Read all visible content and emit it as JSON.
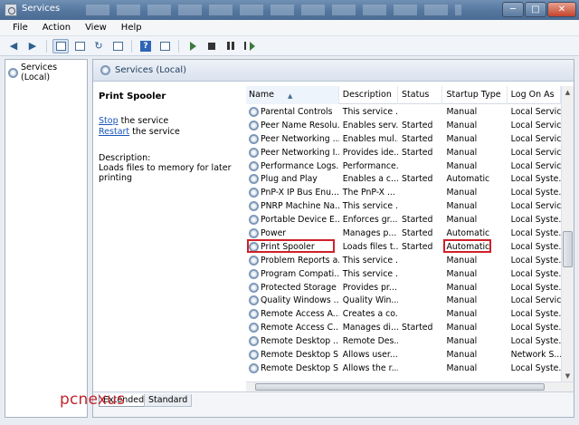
{
  "window": {
    "title": "Services",
    "controls": {
      "minimize": "─",
      "maximize": "□",
      "close": "✕"
    }
  },
  "menu": [
    "File",
    "Action",
    "View",
    "Help"
  ],
  "toolbar": {
    "icons": [
      "back-icon",
      "forward-icon",
      "show-tree-icon",
      "properties-icon",
      "refresh-icon",
      "export-icon",
      "help-icon",
      "view-icon",
      "start-icon",
      "stop-icon",
      "pause-icon",
      "restart-icon"
    ]
  },
  "tree": {
    "root_label": "Services (Local)"
  },
  "pane_header": {
    "title": "Services (Local)"
  },
  "detail": {
    "service_name": "Print Spooler",
    "stop_link": "Stop",
    "stop_suffix": " the service",
    "restart_link": "Restart",
    "restart_suffix": " the service",
    "description_label": "Description:",
    "description_text": "Loads files to memory for later printing"
  },
  "columns": {
    "name": "Name",
    "description": "Description",
    "status": "Status",
    "startup_type": "Startup Type",
    "log_on_as": "Log On As"
  },
  "rows": [
    {
      "name": "Parental Controls",
      "desc": "This service ...",
      "status": "",
      "startup": "Manual",
      "logon": "Local Service"
    },
    {
      "name": "Peer Name Resolu...",
      "desc": "Enables serv...",
      "status": "Started",
      "startup": "Manual",
      "logon": "Local Service"
    },
    {
      "name": "Peer Networking ...",
      "desc": "Enables mul...",
      "status": "Started",
      "startup": "Manual",
      "logon": "Local Service"
    },
    {
      "name": "Peer Networking I...",
      "desc": "Provides ide...",
      "status": "Started",
      "startup": "Manual",
      "logon": "Local Service"
    },
    {
      "name": "Performance Logs...",
      "desc": "Performance...",
      "status": "",
      "startup": "Manual",
      "logon": "Local Service"
    },
    {
      "name": "Plug and Play",
      "desc": "Enables a c...",
      "status": "Started",
      "startup": "Automatic",
      "logon": "Local Syste..."
    },
    {
      "name": "PnP-X IP Bus Enu...",
      "desc": "The PnP-X ...",
      "status": "",
      "startup": "Manual",
      "logon": "Local Syste..."
    },
    {
      "name": "PNRP Machine Na...",
      "desc": "This service ...",
      "status": "",
      "startup": "Manual",
      "logon": "Local Service"
    },
    {
      "name": "Portable Device E...",
      "desc": "Enforces gr...",
      "status": "Started",
      "startup": "Manual",
      "logon": "Local Syste..."
    },
    {
      "name": "Power",
      "desc": "Manages p...",
      "status": "Started",
      "startup": "Automatic",
      "logon": "Local Syste..."
    },
    {
      "name": "Print Spooler",
      "desc": "Loads files t...",
      "status": "Started",
      "startup": "Automatic",
      "logon": "Local Syste..."
    },
    {
      "name": "Problem Reports a...",
      "desc": "This service ...",
      "status": "",
      "startup": "Manual",
      "logon": "Local Syste..."
    },
    {
      "name": "Program Compati...",
      "desc": "This service ...",
      "status": "",
      "startup": "Manual",
      "logon": "Local Syste..."
    },
    {
      "name": "Protected Storage",
      "desc": "Provides pr...",
      "status": "",
      "startup": "Manual",
      "logon": "Local Syste..."
    },
    {
      "name": "Quality Windows ...",
      "desc": "Quality Win...",
      "status": "",
      "startup": "Manual",
      "logon": "Local Service"
    },
    {
      "name": "Remote Access A...",
      "desc": "Creates a co...",
      "status": "",
      "startup": "Manual",
      "logon": "Local Syste..."
    },
    {
      "name": "Remote Access C...",
      "desc": "Manages di...",
      "status": "Started",
      "startup": "Manual",
      "logon": "Local Syste..."
    },
    {
      "name": "Remote Desktop ...",
      "desc": "Remote Des...",
      "status": "",
      "startup": "Manual",
      "logon": "Local Syste..."
    },
    {
      "name": "Remote Desktop S...",
      "desc": "Allows user...",
      "status": "",
      "startup": "Manual",
      "logon": "Network S..."
    },
    {
      "name": "Remote Desktop S...",
      "desc": "Allows the r...",
      "status": "",
      "startup": "Manual",
      "logon": "Local Syste..."
    }
  ],
  "tabs": [
    "Extended",
    "Standard"
  ],
  "watermark": "pcnexus",
  "colors": {
    "highlight": "#d1202a",
    "link": "#1a56b8",
    "watermark": "#c0262c"
  }
}
